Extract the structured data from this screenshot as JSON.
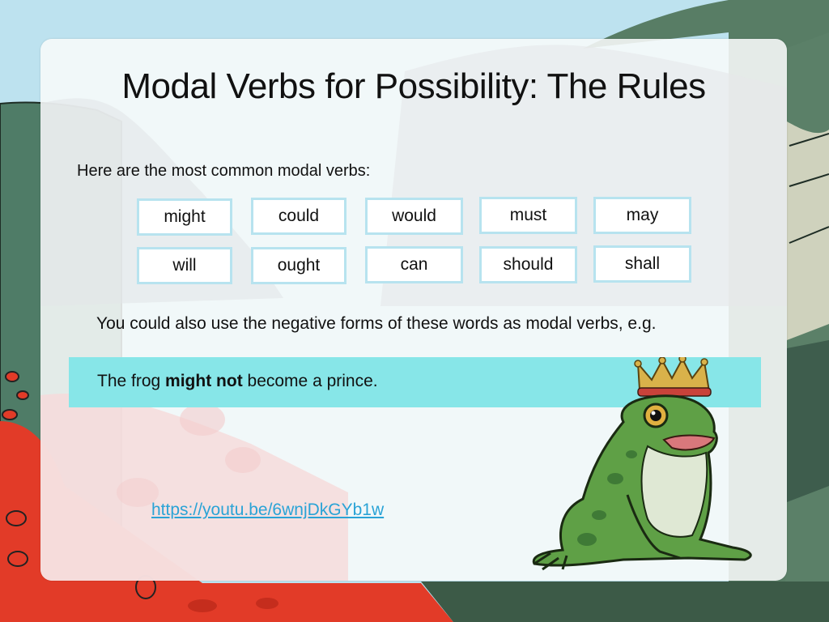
{
  "slide": {
    "title": "Modal Verbs for Possibility: The Rules",
    "intro": "Here are the most common modal verbs:",
    "verbs": {
      "row1": [
        "might",
        "could",
        "would",
        "must",
        "may"
      ],
      "row2": [
        "will",
        "ought",
        "can",
        "should",
        "shall"
      ]
    },
    "negatives_note": "You could also use the negative forms of these words as modal verbs, e.g.",
    "example": {
      "before": "The frog ",
      "emphasis": "might not",
      "after": " become a prince."
    },
    "link": "https://youtu.be/6wnjDkGYb1w",
    "illustration": "frog-prince-with-crown"
  },
  "colors": {
    "sky": "#bde2ef",
    "hills": "#4d7a63",
    "flowers": "#e23b28",
    "verb_box_border": "#b7e3ef",
    "example_band": "#87e6e8",
    "link": "#2aa3d6"
  }
}
